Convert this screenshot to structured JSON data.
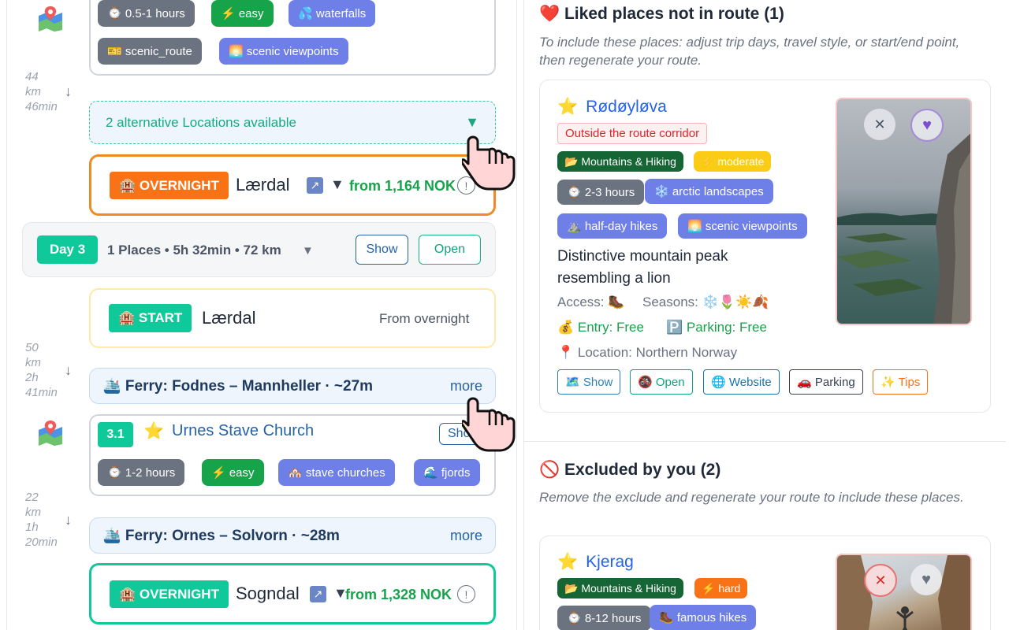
{
  "route": {
    "top_card": {
      "tags_row1": [
        "⌚ 0.5-1 hours",
        "⚡ easy",
        "💦 waterfalls"
      ],
      "tags_row2": [
        "🎫 scenic_route",
        "🌅 scenic viewpoints"
      ]
    },
    "leg1": {
      "dist": "44",
      "dist_unit": "km",
      "time": "46min"
    },
    "alternatives": {
      "label": "2 alternative Locations available",
      "arrow": "▼"
    },
    "overnight1": {
      "badge": "🏨 OVERNIGHT",
      "place": "Lærdal",
      "price": "from 1,164 NOK",
      "info": "!"
    },
    "day3": {
      "badge": "Day 3",
      "summary": "1 Places • 5h 32min • 72 km",
      "chevron": "▼",
      "show": "Show",
      "open": "Open"
    },
    "start": {
      "badge": "🏨 START",
      "place": "Lærdal",
      "from": "From overnight"
    },
    "leg2": {
      "dist": "50",
      "dist_unit": "km",
      "time1": "2h",
      "time2": "41min"
    },
    "ferry1": {
      "title": "🛳️ Ferry: Fodnes – Mannheller · ~27m",
      "more": "more"
    },
    "stop31": {
      "number": "3.1",
      "star": "⭐",
      "name": "Urnes Stave Church",
      "show": "Show",
      "tags": [
        "⌚ 1-2 hours",
        "⚡ easy",
        "🏘️ stave churches",
        "🌊 fjords"
      ]
    },
    "leg3": {
      "dist": "22",
      "dist_unit": "km",
      "time1": "1h",
      "time2": "20min"
    },
    "ferry2": {
      "title": "🛳️ Ferry: Ornes – Solvorn · ~28m",
      "more": "more"
    },
    "overnight2": {
      "badge": "🏨 OVERNIGHT",
      "place": "Sogndal",
      "price": "from 1,328 NOK",
      "info": "!"
    }
  },
  "liked": {
    "header": "❤️ Liked places not in route (1)",
    "subtitle": "To include these places: adjust trip days, travel style, or start/end point, then regenerate your route.",
    "place": {
      "star": "⭐",
      "name": "Rødøyløva",
      "warning": "Outside the route corridor",
      "tags_row1": [
        "📂 Mountains & Hiking",
        "⚡ moderate"
      ],
      "tags_row2": [
        "⌚ 2-3 hours",
        "❄️ arctic landscapes"
      ],
      "tags_row3": [
        "⛰️ half-day hikes",
        "🌅 scenic viewpoints"
      ],
      "description": "Distinctive mountain peak resembling a lion",
      "access_label": "Access: 🥾",
      "seasons_label": "Seasons: ❄️🌷☀️🍂",
      "entry": "💰 Entry: Free",
      "parking": "🅿️ Parking: Free",
      "location": "📍 Location: Northern Norway",
      "actions": [
        "🗺️ Show",
        "🚳 Open",
        "🌐 Website",
        "🚗 Parking",
        "✨ Tips"
      ],
      "close": "✕",
      "heart": "♥"
    }
  },
  "excluded": {
    "header": "🚫 Excluded by you (2)",
    "subtitle": "Remove the exclude and regenerate your route to include these places.",
    "place": {
      "star": "⭐",
      "name": "Kjerag",
      "tags_row1": [
        "📂 Mountains & Hiking",
        "⚡ hard"
      ],
      "tags_row2": [
        "⌚ 8-12 hours",
        "🥾 famous hikes"
      ],
      "close": "✕",
      "heart": "♥"
    }
  },
  "colors": {
    "teal": "#10c99a",
    "orange_border": "#f08a24",
    "overnight_badge": "#f97316",
    "link_blue": "#2563eb"
  }
}
